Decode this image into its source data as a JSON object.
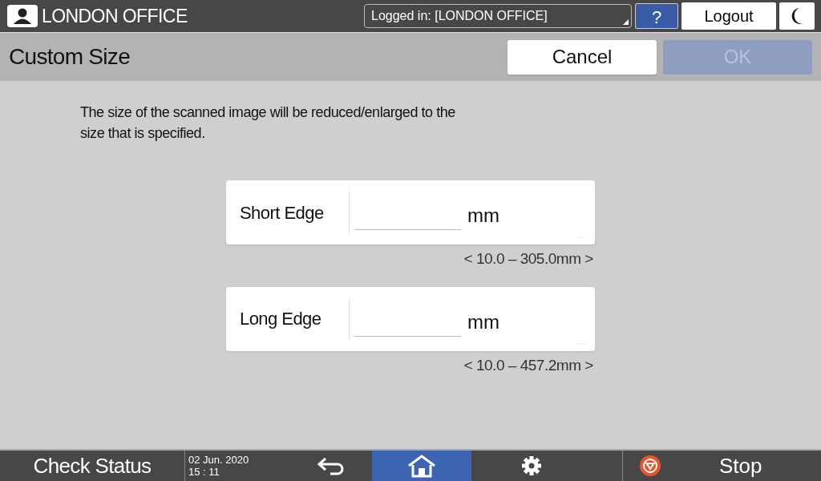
{
  "header": {
    "user": "LONDON OFFICE",
    "login": "Logged in: [LONDON OFFICE]",
    "help": "?",
    "logout": "Logout"
  },
  "title_bar": {
    "title": "Custom Size",
    "buttons": [
      {
        "label": "Cancel",
        "disabled": false
      },
      {
        "label": "OK",
        "disabled": true
      }
    ]
  },
  "description": "The size of the scanned image will be reduced/enlarged to the size that is specified.",
  "fields": [
    {
      "label": "Short Edge",
      "unit": "mm",
      "range": "< 10.0 – 305.0mm >"
    },
    {
      "label": "Long Edge",
      "unit": "mm",
      "range": "< 10.0 – 457.2mm >"
    }
  ],
  "footer": {
    "check_status": "Check Status",
    "date": "02 Jun. 2020",
    "time": "15 : 11",
    "home_selected": true,
    "stop": "Stop"
  }
}
